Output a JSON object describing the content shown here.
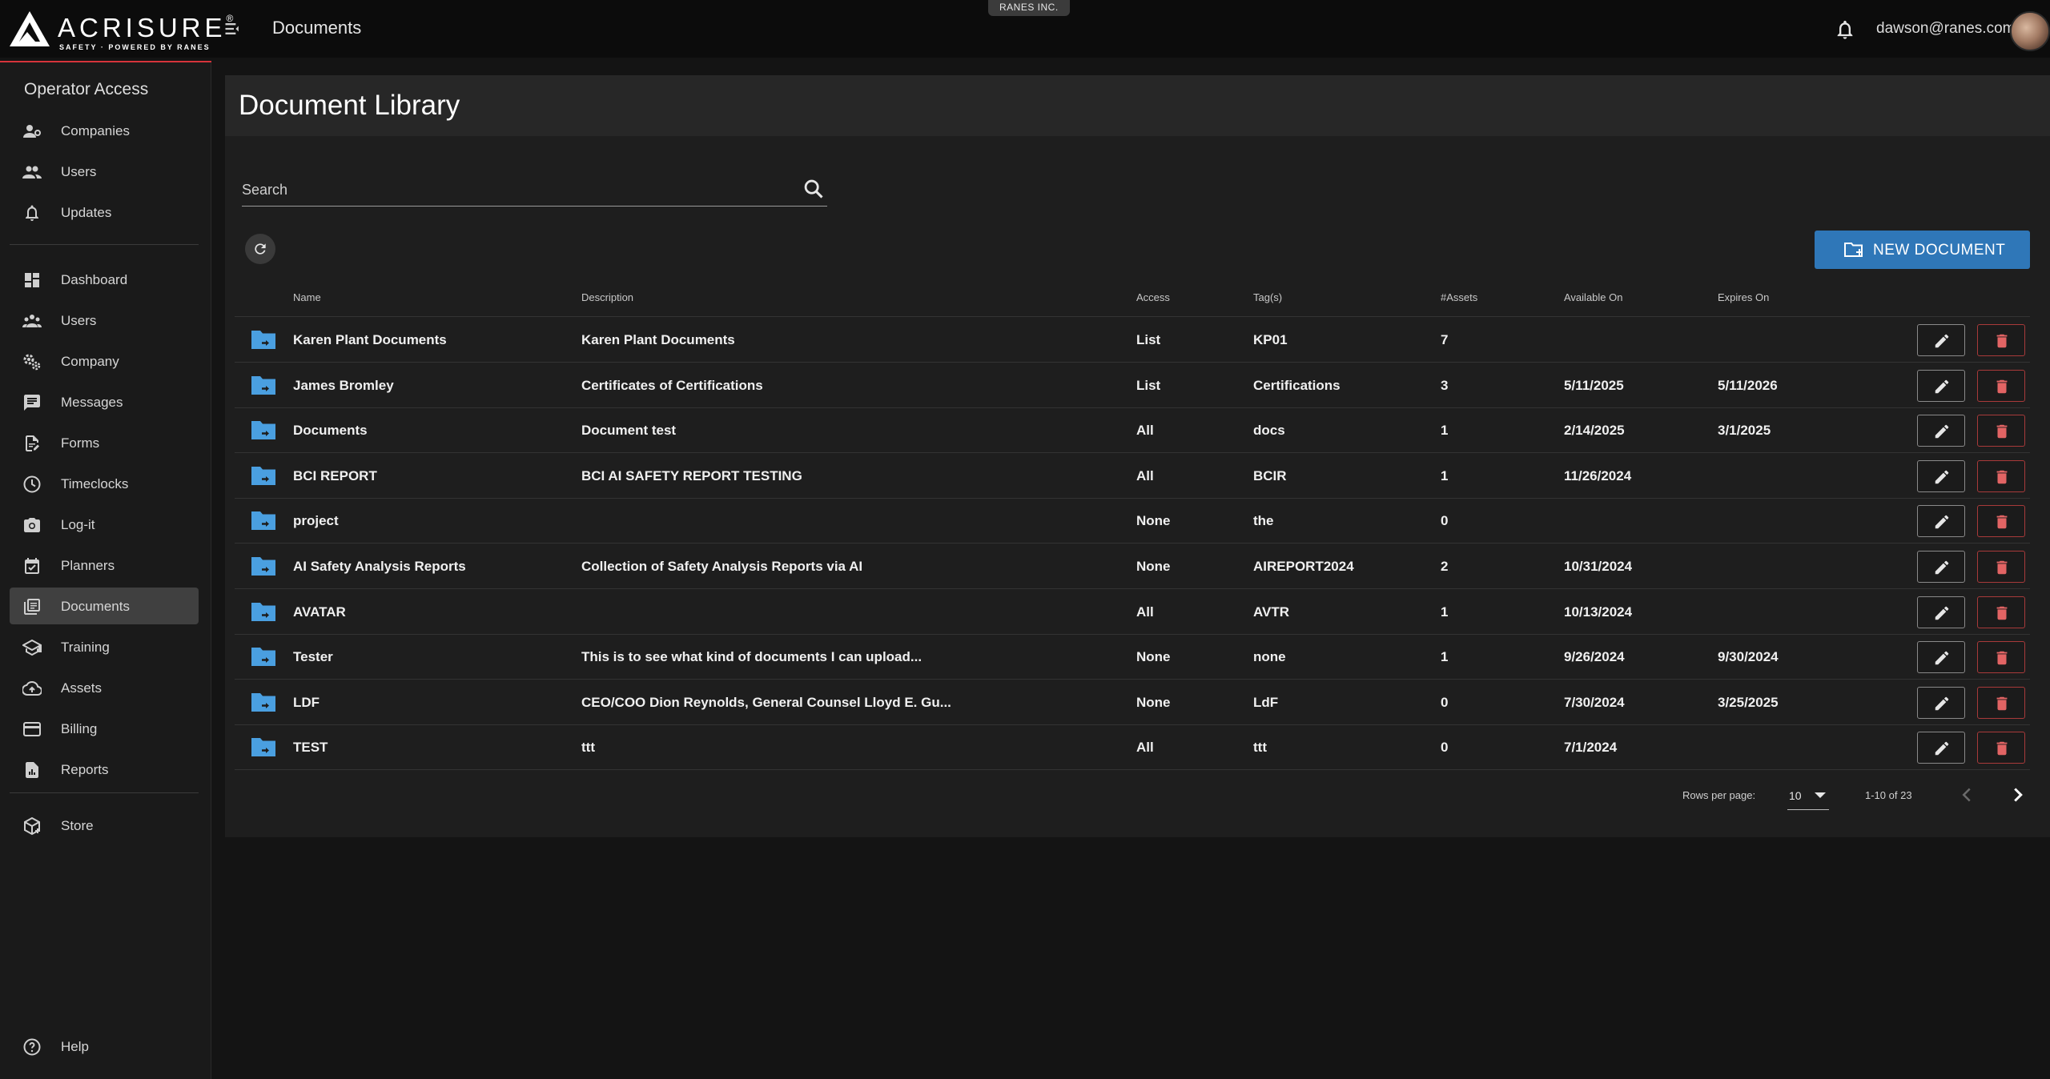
{
  "app": {
    "logo_name": "ACRISURE",
    "logo_reg": "®",
    "logo_tagline": "SAFETY · POWERED BY RANES",
    "page_title": "Documents",
    "company": "RANES INC.",
    "user_email": "dawson@ranes.com"
  },
  "sidebar": {
    "heading": "Operator Access",
    "operator_items": [
      {
        "label": "Companies",
        "icon": "companies-icon"
      },
      {
        "label": "Users",
        "icon": "users-icon"
      },
      {
        "label": "Updates",
        "icon": "bell-icon"
      }
    ],
    "items": [
      {
        "label": "Dashboard",
        "icon": "dashboard-icon"
      },
      {
        "label": "Users",
        "icon": "users-icon"
      },
      {
        "label": "Company",
        "icon": "gears-icon"
      },
      {
        "label": "Messages",
        "icon": "message-icon"
      },
      {
        "label": "Forms",
        "icon": "form-icon"
      },
      {
        "label": "Timeclocks",
        "icon": "clock-icon"
      },
      {
        "label": "Log-it",
        "icon": "camera-icon"
      },
      {
        "label": "Planners",
        "icon": "calendar-icon"
      },
      {
        "label": "Documents",
        "icon": "documents-icon",
        "active": true
      },
      {
        "label": "Training",
        "icon": "graduation-icon"
      },
      {
        "label": "Assets",
        "icon": "cloud-icon"
      },
      {
        "label": "Billing",
        "icon": "credit-card-icon"
      },
      {
        "label": "Reports",
        "icon": "report-icon"
      }
    ],
    "store": {
      "label": "Store",
      "icon": "store-icon"
    },
    "help": {
      "label": "Help",
      "icon": "help-icon"
    }
  },
  "library": {
    "title": "Document Library",
    "search_placeholder": "Search",
    "new_document_label": "NEW DOCUMENT",
    "columns": [
      "Name",
      "Description",
      "Access",
      "Tag(s)",
      "#Assets",
      "Available On",
      "Expires On"
    ],
    "rows": [
      {
        "name": "Karen Plant Documents",
        "description": "Karen Plant Documents",
        "access": "List",
        "tags": "KP01",
        "assets": "7",
        "available": "",
        "expires": ""
      },
      {
        "name": "James Bromley",
        "description": "Certificates of Certifications",
        "access": "List",
        "tags": "Certifications",
        "assets": "3",
        "available": "5/11/2025",
        "expires": "5/11/2026"
      },
      {
        "name": "Documents",
        "description": "Document test",
        "access": "All",
        "tags": "docs",
        "assets": "1",
        "available": "2/14/2025",
        "expires": "3/1/2025"
      },
      {
        "name": "BCI REPORT",
        "description": "BCI AI SAFETY REPORT TESTING",
        "access": "All",
        "tags": "BCIR",
        "assets": "1",
        "available": "11/26/2024",
        "expires": ""
      },
      {
        "name": "project",
        "description": "",
        "access": "None",
        "tags": "the",
        "assets": "0",
        "available": "",
        "expires": ""
      },
      {
        "name": "AI Safety Analysis Reports",
        "description": "Collection of Safety Analysis Reports via AI",
        "access": "None",
        "tags": "AIREPORT2024",
        "assets": "2",
        "available": "10/31/2024",
        "expires": ""
      },
      {
        "name": "AVATAR",
        "description": "",
        "access": "All",
        "tags": "AVTR",
        "assets": "1",
        "available": "10/13/2024",
        "expires": ""
      },
      {
        "name": "Tester",
        "description": "This is to see what kind of documents I can upload...",
        "access": "None",
        "tags": "none",
        "assets": "1",
        "available": "9/26/2024",
        "expires": "9/30/2024"
      },
      {
        "name": "LDF",
        "description": "CEO/COO Dion Reynolds, General Counsel Lloyd E. Gu...",
        "access": "None",
        "tags": "LdF",
        "assets": "0",
        "available": "7/30/2024",
        "expires": "3/25/2025"
      },
      {
        "name": "TEST",
        "description": "ttt",
        "access": "All",
        "tags": "ttt",
        "assets": "0",
        "available": "7/1/2024",
        "expires": ""
      }
    ],
    "pagination": {
      "rows_per_page_label": "Rows per page:",
      "rows_per_page": "10",
      "range": "1-10 of 23"
    }
  },
  "colors": {
    "accent": "#2f77b8",
    "brand_red": "#d6343b",
    "folder": "#4a9fe0",
    "delete": "#e26464"
  }
}
